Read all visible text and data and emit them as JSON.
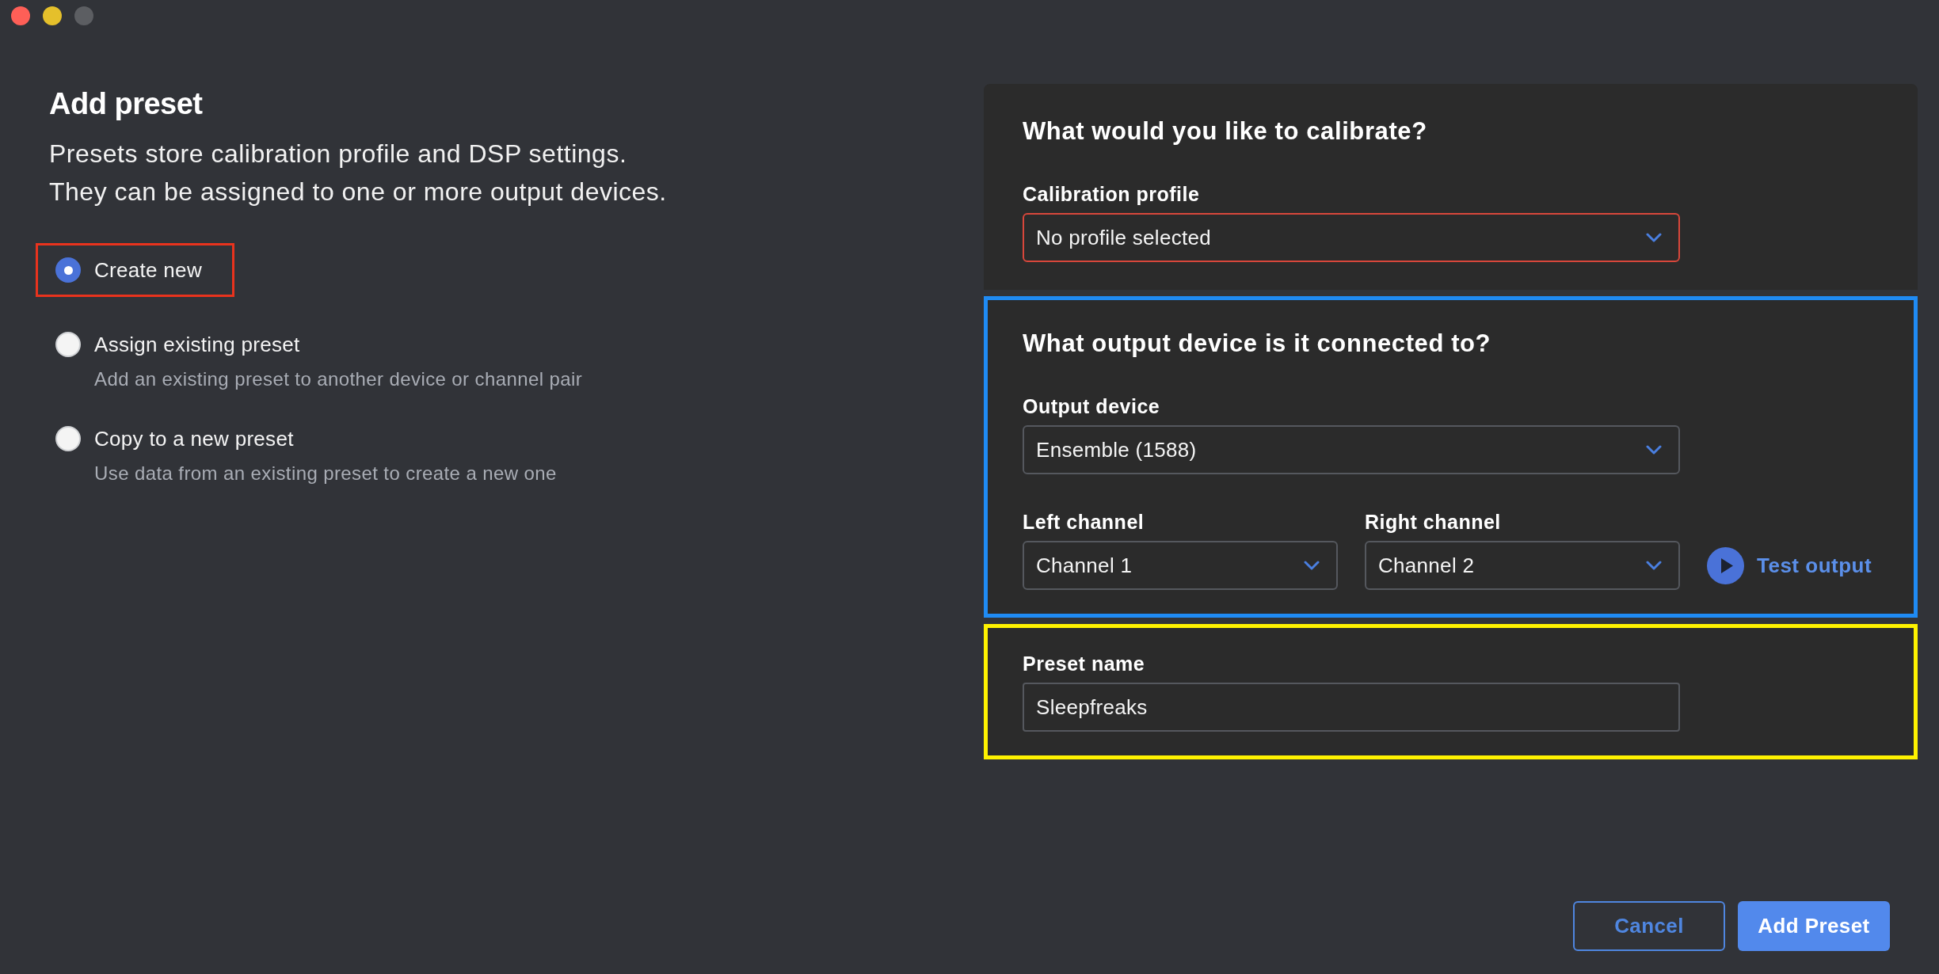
{
  "window_controls": [
    {
      "kind": "close",
      "disabled": false
    },
    {
      "kind": "minimize",
      "disabled": false
    },
    {
      "kind": "zoom",
      "disabled": true
    }
  ],
  "title": "Add preset",
  "description_lines": [
    "Presets store calibration profile and DSP settings.",
    "They can be assigned to one or more output devices."
  ],
  "options": [
    {
      "label": "Create new",
      "selected": true,
      "color": "#e9331d"
    },
    {
      "label": "Assign existing preset",
      "description": "Add an existing preset to another device or channel pair",
      "selected": false
    },
    {
      "label": "Copy to a new preset",
      "description": "Use data from an existing preset to create a new one",
      "selected": false
    }
  ],
  "sections": [
    {
      "heading": "What would you like to calibrate?",
      "rows": [
        {
          "items": [
            {
              "kind": "select",
              "label": "Calibration profile",
              "value": "No profile selected",
              "invalid": true
            }
          ]
        }
      ]
    },
    {
      "heading": "What output device is it connected to?",
      "color": "#1f8bf4",
      "rows": [
        {
          "items": [
            {
              "kind": "select",
              "label": "Output device",
              "value": "Ensemble (1588)",
              "invalid": false
            }
          ]
        },
        {
          "items": [
            {
              "kind": "select",
              "label": "Left channel",
              "value": "Channel 1",
              "invalid": false
            },
            {
              "kind": "select",
              "label": "Right channel",
              "value": "Channel 2",
              "invalid": false
            },
            {
              "kind": "play_button",
              "label": "Test output"
            }
          ]
        }
      ]
    },
    {
      "color": "#fef200",
      "rows": [
        {
          "items": [
            {
              "kind": "text_input",
              "label": "Preset name",
              "value": "Sleepfreaks",
              "invalid": false
            }
          ]
        }
      ]
    }
  ],
  "buttons": [
    {
      "label": "Cancel",
      "kind": "secondary"
    },
    {
      "label": "Add Preset",
      "kind": "primary"
    }
  ]
}
